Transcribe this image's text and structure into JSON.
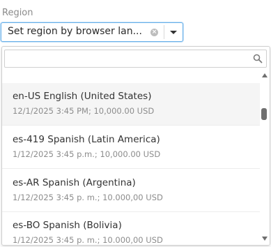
{
  "field": {
    "label": "Region"
  },
  "select": {
    "value": "Set region by browser language",
    "display_value": "Set region by browser lan...",
    "clear_icon": "clear-circle-icon",
    "toggle_icon": "chevron-down-icon"
  },
  "search": {
    "value": "",
    "placeholder": "",
    "icon": "search-icon"
  },
  "options": [
    {
      "label": "en-US English (United States)",
      "example": "12/1/2025 3:45 PM; 10,000.00 USD",
      "highlighted": true
    },
    {
      "label": "es-419 Spanish (Latin America)",
      "example": "1/12/2025 3:45 p.m.; 10,000.00 USD",
      "highlighted": false
    },
    {
      "label": "es-AR Spanish (Argentina)",
      "example": "1/12/2025 3:45 p. m.; 10.000,00 USD",
      "highlighted": false
    },
    {
      "label": "es-BO Spanish (Bolivia)",
      "example": "1/12/2025 3:45 p. m.; 10.000,00 USD",
      "highlighted": false
    }
  ],
  "scroll": {
    "up_icon": "scroll-up-arrow-icon",
    "down_icon": "scroll-down-arrow-icon"
  },
  "colors": {
    "focus_border": "#66afe9",
    "highlight_bg": "#f5f5f5",
    "secondary_text": "#8c8c8c"
  }
}
